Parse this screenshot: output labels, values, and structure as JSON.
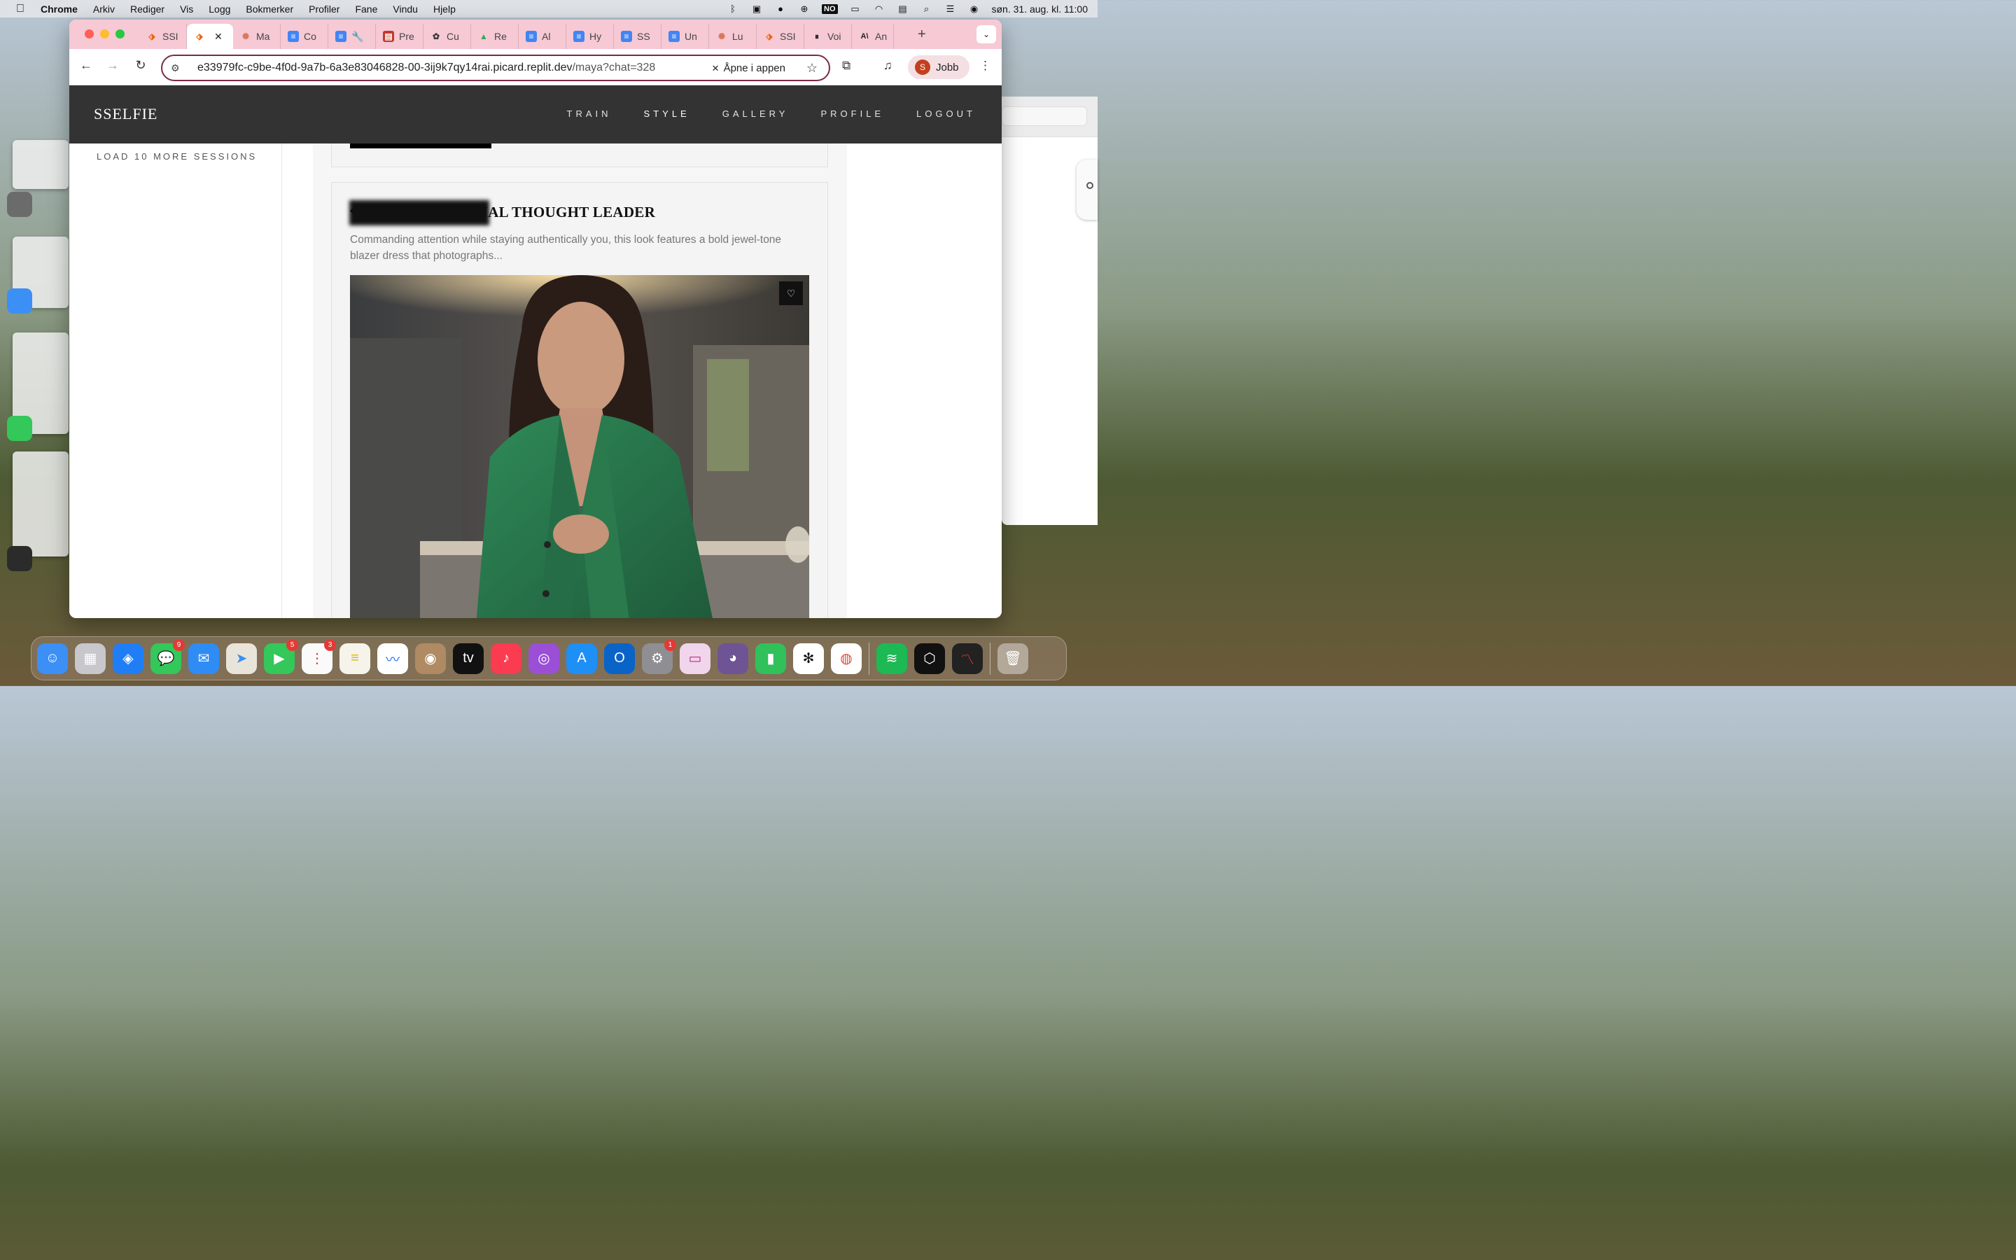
{
  "menubar": {
    "app_name": "Chrome",
    "menus": [
      "Arkiv",
      "Rediger",
      "Vis",
      "Logg",
      "Bokmerker",
      "Profiler",
      "Fane",
      "Vindu",
      "Hjelp"
    ],
    "input_source": "NO",
    "clock": "søn. 31. aug. kl. 11:00"
  },
  "browser": {
    "tabs": [
      {
        "label": "SSI",
        "icon": "replit-icon",
        "color": "#f26207"
      },
      {
        "label": "",
        "icon": "replit-icon",
        "color": "#f26207",
        "active": true
      },
      {
        "label": "Ma",
        "icon": "claude-icon",
        "color": "#d97757"
      },
      {
        "label": "Co",
        "icon": "docs-icon",
        "color": "#4285f4"
      },
      {
        "label": "🔧",
        "icon": "docs-icon",
        "color": "#4285f4"
      },
      {
        "label": "Pre",
        "icon": "presentation-icon",
        "color": "#c0392b"
      },
      {
        "label": "Cu",
        "icon": "chatgpt-icon",
        "color": "#333333"
      },
      {
        "label": "Re",
        "icon": "drive-icon",
        "color": "#34a853"
      },
      {
        "label": "Al",
        "icon": "docs-icon",
        "color": "#4285f4"
      },
      {
        "label": "Hy",
        "icon": "docs-icon",
        "color": "#4285f4"
      },
      {
        "label": "SS",
        "icon": "docs-icon",
        "color": "#4285f4"
      },
      {
        "label": "Un",
        "icon": "docs-icon",
        "color": "#4285f4"
      },
      {
        "label": "Lu",
        "icon": "claude-icon",
        "color": "#d97757"
      },
      {
        "label": "SSI",
        "icon": "replit-icon",
        "color": "#f26207"
      },
      {
        "label": "Voi",
        "icon": "pause-icon",
        "color": "#222222"
      },
      {
        "label": "An",
        "icon": "anthropic-icon",
        "color": "#222222"
      }
    ],
    "url_host": "e33979fc-c9be-4f0d-9a7b-6a3e83046828-00-3ij9k7qy14rai.picard.replit.dev",
    "url_path": "/maya?chat=328",
    "open_in_app": "Åpne i appen",
    "profile_initial": "S",
    "profile_name": "Jobb"
  },
  "site": {
    "logo": "SSELFIE",
    "nav": [
      "TRAIN",
      "STYLE",
      "GALLERY",
      "PROFILE",
      "LOGOUT"
    ],
    "active_nav": "STYLE",
    "sidebar": {
      "load_more": "LOAD 10 MORE SESSIONS"
    },
    "card": {
      "title": "� THE INFLUENTIAL THOUGHT LEADER",
      "description": "Commanding attention while staying authentically you, this look features a bold jewel-tone blazer dress that photographs..."
    }
  },
  "dock": {
    "badges": {
      "messages": "9",
      "facetime": "5",
      "reminders": "3",
      "settings": "1"
    }
  },
  "colors": {
    "tab_bar": "#f6c9d4",
    "omnibox_border": "#7a2b45",
    "site_header": "#333333",
    "blazer_green": "#2f7a4f"
  }
}
